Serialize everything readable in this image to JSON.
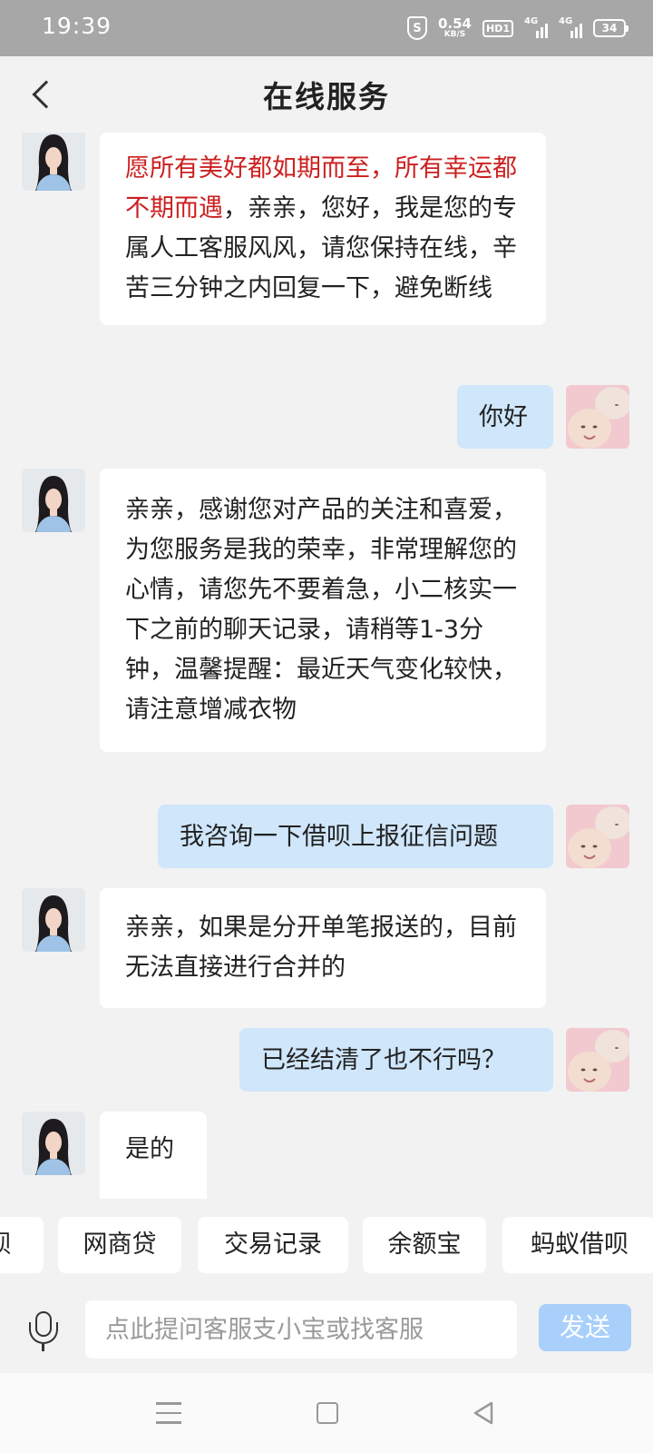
{
  "status_bar": {
    "time": "19:39",
    "speed_value": "0.54",
    "speed_unit": "KB/S",
    "hd_label": "HD1",
    "signal1_label": "4G",
    "signal2_label": "4G",
    "battery": "34",
    "icons": [
      "shield-s-icon",
      "hd-icon",
      "signal-icon",
      "signal-icon",
      "battery-icon"
    ]
  },
  "header": {
    "title": "在线服务",
    "back_icon": "chevron-left-icon"
  },
  "messages": [
    {
      "from": "agent",
      "highlight": "愿所有美好都如期而至，所有幸运都不期而遇",
      "text": "，亲亲，您好，我是您的专属人工客服风风，请您保持在线，辛苦三分钟之内回复一下，避免断线"
    },
    {
      "from": "user",
      "text": "你好"
    },
    {
      "from": "agent",
      "text": "亲亲，感谢您对产品的关注和喜爱，为您服务是我的荣幸，非常理解您的心情，请您先不要着急，小二核实一下之前的聊天记录，请稍等1-3分钟，温馨提醒：最近天气变化较快，请注意增减衣物"
    },
    {
      "from": "user",
      "text": "我咨询一下借呗上报征信问题"
    },
    {
      "from": "agent",
      "text": "亲亲，如果是分开单笔报送的，目前无法直接进行合并的"
    },
    {
      "from": "user",
      "text": "已经结清了也不行吗？"
    },
    {
      "from": "agent",
      "text": "是的"
    }
  ],
  "quick_chips": [
    "呗",
    "网商贷",
    "交易记录",
    "余额宝",
    "蚂蚁借呗"
  ],
  "input": {
    "placeholder": "点此提问客服支小宝或找客服",
    "value": "",
    "send_label": "发送",
    "send_color": "#a9d0fb"
  },
  "colors": {
    "background": "#f2f2f2",
    "agent_bubble": "#ffffff",
    "user_bubble": "#cfe6fb",
    "highlight_text": "#cc1f1f",
    "status_bar": "#a7a7a7"
  },
  "nav_icons": [
    "menu-icon",
    "home-square-icon",
    "back-triangle-icon"
  ]
}
